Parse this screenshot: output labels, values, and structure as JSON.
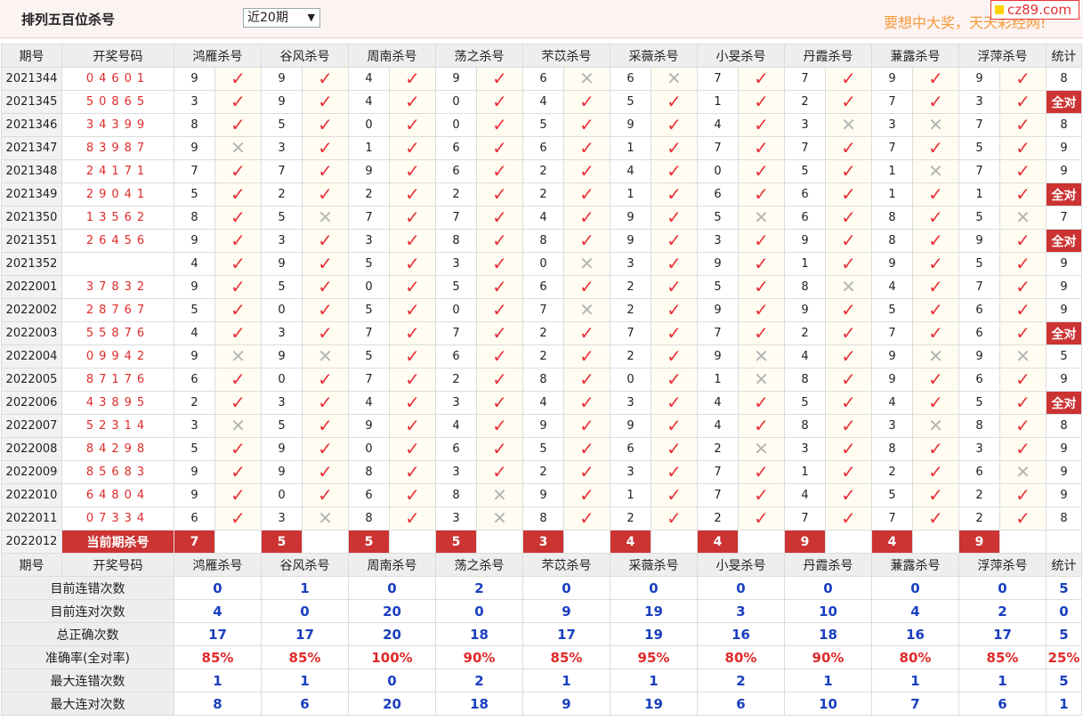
{
  "header": {
    "title": "排列五百位杀号",
    "period_select": "近20期",
    "slogan": "要想中大奖，天天彩经网!",
    "logo": "cz89.com"
  },
  "columns": {
    "period": "期号",
    "draw": "开奖号码",
    "experts": [
      "鸿雁杀号",
      "谷风杀号",
      "周南杀号",
      "荡之杀号",
      "芣苡杀号",
      "采薇杀号",
      "小旻杀号",
      "丹霞杀号",
      "蒹露杀号",
      "浮萍杀号"
    ],
    "stat": "统计"
  },
  "rows": [
    {
      "period": "2021344",
      "draw": "04601",
      "kills": [
        9,
        9,
        4,
        9,
        6,
        6,
        7,
        7,
        9,
        9
      ],
      "ok": [
        1,
        1,
        1,
        1,
        0,
        0,
        1,
        1,
        1,
        1
      ],
      "stat": "8"
    },
    {
      "period": "2021345",
      "draw": "50865",
      "kills": [
        3,
        9,
        4,
        0,
        4,
        5,
        1,
        2,
        7,
        3
      ],
      "ok": [
        1,
        1,
        1,
        1,
        1,
        1,
        1,
        1,
        1,
        1
      ],
      "stat": "全对"
    },
    {
      "period": "2021346",
      "draw": "34399",
      "kills": [
        8,
        5,
        0,
        0,
        5,
        9,
        4,
        3,
        3,
        7
      ],
      "ok": [
        1,
        1,
        1,
        1,
        1,
        1,
        1,
        0,
        0,
        1
      ],
      "stat": "8"
    },
    {
      "period": "2021347",
      "draw": "83987",
      "kills": [
        9,
        3,
        1,
        6,
        6,
        1,
        7,
        7,
        7,
        5
      ],
      "ok": [
        0,
        1,
        1,
        1,
        1,
        1,
        1,
        1,
        1,
        1
      ],
      "stat": "9"
    },
    {
      "period": "2021348",
      "draw": "24171",
      "kills": [
        7,
        7,
        9,
        6,
        2,
        4,
        0,
        5,
        1,
        7
      ],
      "ok": [
        1,
        1,
        1,
        1,
        1,
        1,
        1,
        1,
        0,
        1
      ],
      "stat": "9"
    },
    {
      "period": "2021349",
      "draw": "29041",
      "kills": [
        5,
        2,
        2,
        2,
        2,
        1,
        6,
        6,
        1,
        1
      ],
      "ok": [
        1,
        1,
        1,
        1,
        1,
        1,
        1,
        1,
        1,
        1
      ],
      "stat": "全对"
    },
    {
      "period": "2021350",
      "draw": "13562",
      "kills": [
        8,
        5,
        7,
        7,
        4,
        9,
        5,
        6,
        8,
        5
      ],
      "ok": [
        1,
        0,
        1,
        1,
        1,
        1,
        0,
        1,
        1,
        0
      ],
      "stat": "7"
    },
    {
      "period": "2021351",
      "draw": "26456",
      "kills": [
        9,
        3,
        3,
        8,
        8,
        9,
        3,
        9,
        8,
        9
      ],
      "ok": [
        1,
        1,
        1,
        1,
        1,
        1,
        1,
        1,
        1,
        1
      ],
      "stat": "全对"
    },
    {
      "period": "2021352",
      "draw": "",
      "kills": [
        4,
        9,
        5,
        3,
        0,
        3,
        9,
        1,
        9,
        5
      ],
      "ok": [
        1,
        1,
        1,
        1,
        0,
        1,
        1,
        1,
        1,
        1
      ],
      "stat": "9"
    },
    {
      "period": "2022001",
      "draw": "37832",
      "kills": [
        9,
        5,
        0,
        5,
        6,
        2,
        5,
        8,
        4,
        7
      ],
      "ok": [
        1,
        1,
        1,
        1,
        1,
        1,
        1,
        0,
        1,
        1
      ],
      "stat": "9"
    },
    {
      "period": "2022002",
      "draw": "28767",
      "kills": [
        5,
        0,
        5,
        0,
        7,
        2,
        9,
        9,
        5,
        6
      ],
      "ok": [
        1,
        1,
        1,
        1,
        0,
        1,
        1,
        1,
        1,
        1
      ],
      "stat": "9"
    },
    {
      "period": "2022003",
      "draw": "55876",
      "kills": [
        4,
        3,
        7,
        7,
        2,
        7,
        7,
        2,
        7,
        6
      ],
      "ok": [
        1,
        1,
        1,
        1,
        1,
        1,
        1,
        1,
        1,
        1
      ],
      "stat": "全对"
    },
    {
      "period": "2022004",
      "draw": "09942",
      "kills": [
        9,
        9,
        5,
        6,
        2,
        2,
        9,
        4,
        9,
        9
      ],
      "ok": [
        0,
        0,
        1,
        1,
        1,
        1,
        0,
        1,
        0,
        0
      ],
      "stat": "5"
    },
    {
      "period": "2022005",
      "draw": "87176",
      "kills": [
        6,
        0,
        7,
        2,
        8,
        0,
        1,
        8,
        9,
        6
      ],
      "ok": [
        1,
        1,
        1,
        1,
        1,
        1,
        0,
        1,
        1,
        1
      ],
      "stat": "9"
    },
    {
      "period": "2022006",
      "draw": "43895",
      "kills": [
        2,
        3,
        4,
        3,
        4,
        3,
        4,
        5,
        4,
        5
      ],
      "ok": [
        1,
        1,
        1,
        1,
        1,
        1,
        1,
        1,
        1,
        1
      ],
      "stat": "全对"
    },
    {
      "period": "2022007",
      "draw": "52314",
      "kills": [
        3,
        5,
        9,
        4,
        9,
        9,
        4,
        8,
        3,
        8
      ],
      "ok": [
        0,
        1,
        1,
        1,
        1,
        1,
        1,
        1,
        0,
        1
      ],
      "stat": "8"
    },
    {
      "period": "2022008",
      "draw": "84298",
      "kills": [
        5,
        9,
        0,
        6,
        5,
        6,
        2,
        3,
        8,
        3
      ],
      "ok": [
        1,
        1,
        1,
        1,
        1,
        1,
        0,
        1,
        1,
        1
      ],
      "stat": "9"
    },
    {
      "period": "2022009",
      "draw": "85683",
      "kills": [
        9,
        9,
        8,
        3,
        2,
        3,
        7,
        1,
        2,
        6
      ],
      "ok": [
        1,
        1,
        1,
        1,
        1,
        1,
        1,
        1,
        1,
        0
      ],
      "stat": "9"
    },
    {
      "period": "2022010",
      "draw": "64804",
      "kills": [
        9,
        0,
        6,
        8,
        9,
        1,
        7,
        4,
        5,
        2
      ],
      "ok": [
        1,
        1,
        1,
        0,
        1,
        1,
        1,
        1,
        1,
        1
      ],
      "stat": "9"
    },
    {
      "period": "2022011",
      "draw": "07334",
      "kills": [
        6,
        3,
        8,
        3,
        8,
        2,
        2,
        7,
        7,
        2
      ],
      "ok": [
        1,
        0,
        1,
        0,
        1,
        1,
        1,
        1,
        1,
        1
      ],
      "stat": "8"
    }
  ],
  "current": {
    "period": "2022012",
    "label": "当前期杀号",
    "kills": [
      7,
      5,
      5,
      5,
      3,
      4,
      4,
      9,
      4,
      9
    ]
  },
  "summary": [
    {
      "label": "目前连错次数",
      "values": [
        "0",
        "1",
        "0",
        "2",
        "0",
        "0",
        "0",
        "0",
        "0",
        "0"
      ],
      "stat": "5",
      "kind": "val"
    },
    {
      "label": "目前连对次数",
      "values": [
        "4",
        "0",
        "20",
        "0",
        "9",
        "19",
        "3",
        "10",
        "4",
        "2"
      ],
      "stat": "0",
      "kind": "val"
    },
    {
      "label": "总正确次数",
      "values": [
        "17",
        "17",
        "20",
        "18",
        "17",
        "19",
        "16",
        "18",
        "16",
        "17"
      ],
      "stat": "5",
      "kind": "val"
    },
    {
      "label": "准确率(全对率)",
      "values": [
        "85%",
        "85%",
        "100%",
        "90%",
        "85%",
        "95%",
        "80%",
        "90%",
        "80%",
        "85%"
      ],
      "stat": "25%",
      "kind": "rate"
    },
    {
      "label": "最大连错次数",
      "values": [
        "1",
        "1",
        "0",
        "2",
        "1",
        "1",
        "2",
        "1",
        "1",
        "1"
      ],
      "stat": "5",
      "kind": "val"
    },
    {
      "label": "最大连对次数",
      "values": [
        "8",
        "6",
        "20",
        "18",
        "9",
        "19",
        "6",
        "10",
        "7",
        "6"
      ],
      "stat": "1",
      "kind": "val"
    }
  ],
  "icons": {
    "check": "check-icon",
    "cross": "cross-icon"
  },
  "colors": {
    "accent": "#cc3333",
    "check": "#e8313a",
    "cross": "#b5b5b5",
    "summary": "#1a3fbf",
    "slogan": "#f39b3a"
  }
}
